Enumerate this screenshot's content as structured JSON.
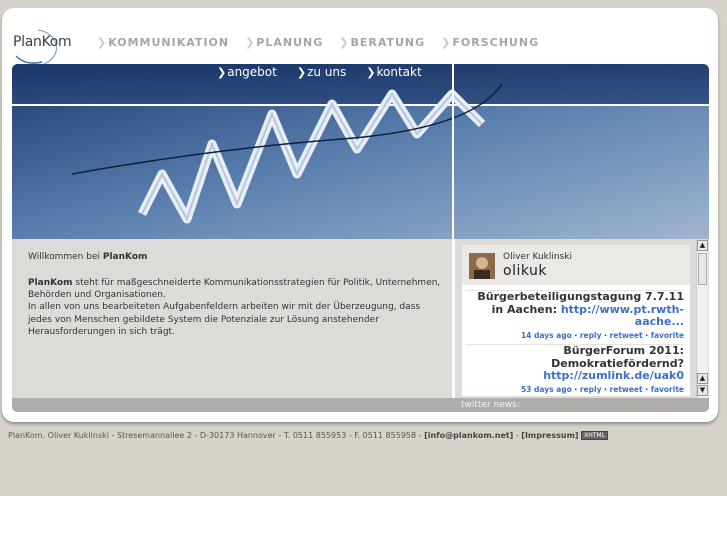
{
  "logo": {
    "text": "PlanKom"
  },
  "topnav": {
    "items": [
      "KOMMUNIKATION",
      "PLANUNG",
      "BERATUNG",
      "FORSCHUNG"
    ]
  },
  "hero": {
    "nav": [
      "angebot",
      "zu uns",
      "kontakt"
    ]
  },
  "content": {
    "welcome_prefix": "Willkommen bei ",
    "welcome_brand": "PlanKom",
    "intro_brand": "PlanKom",
    "intro_text1": " steht für maßgeschneiderte Kommunikationsstrategien für Politik, Unternehmen, Behörden und Organisationen.",
    "intro_text2": "In allen von uns bearbeiteten Aufgabenfeldern arbeiten wir mit der Überzeugung, dass jedes von Menschen gebildete System die Potenziale zur Lösung anstehender Herausforderungen in sich trägt."
  },
  "twitter": {
    "name": "Oliver Kuklinski",
    "handle": "olikuk",
    "label": "twitter news:",
    "tweets": [
      {
        "text": "Bürgerbeteiligungstagung 7.7.11 in Aachen: ",
        "link": "http://www.pt.rwth-aache...",
        "time": "14 days ago",
        "reply": "reply",
        "retweet": "retweet",
        "favorite": "favorite"
      },
      {
        "text": "BürgerForum 2011: Demokratiefördernd? ",
        "link": "http://zumlink.de/uak0",
        "time": "53 days ago",
        "reply": "reply",
        "retweet": "retweet",
        "favorite": "favorite"
      }
    ]
  },
  "footer": {
    "text": "PlanKom. Oliver Kuklinski - Stresemannallee 2 - D-30173 Hannover - T. 0511 855953 - F. 0511 855958 - ",
    "email": "[info@plankom.net]",
    "sep": " - ",
    "impressum": "[Impressum]",
    "badge": "XHTML"
  },
  "colors": {
    "band": "#d7d3cb",
    "panel": "#dddbd8",
    "link": "#3b6fc9",
    "hero_blue": "#1d3d72"
  }
}
